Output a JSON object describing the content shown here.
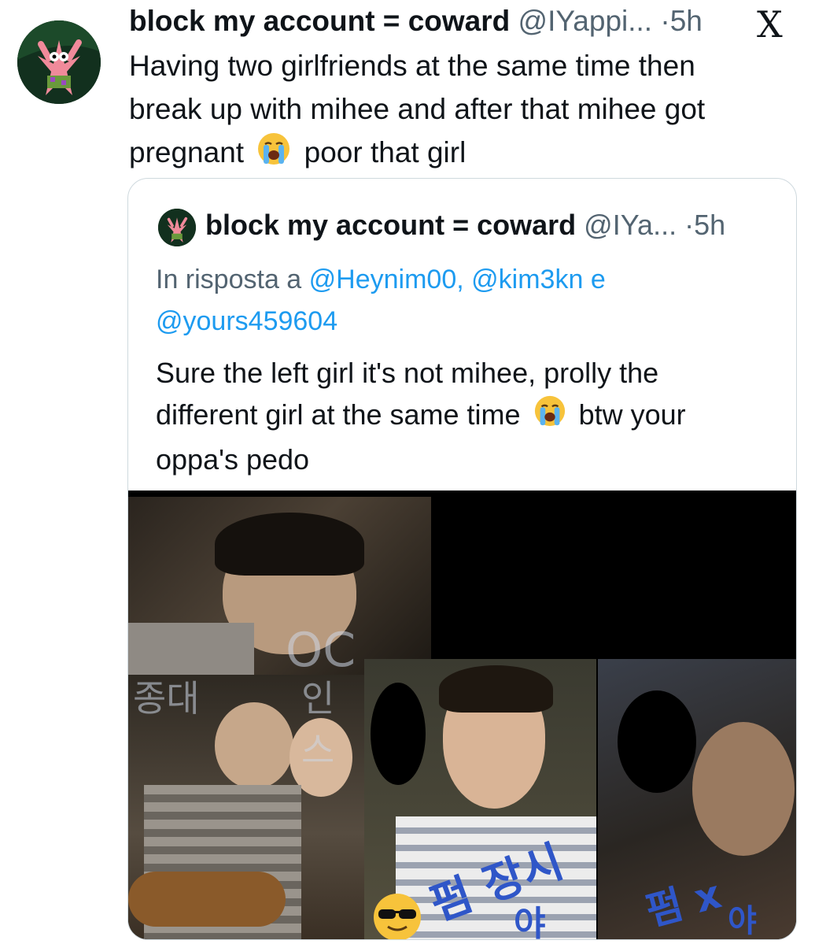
{
  "tweet": {
    "author_name": "block my account = coward",
    "author_handle": "@IYappi...",
    "separator": "·",
    "time": "5h",
    "text_line1": "Having two girlfriends at the same time then",
    "text_line2": "break up with mihee and after that mihee got",
    "text_line3a": "pregnant",
    "text_line3b": "poor that girl"
  },
  "platform_logo": "X",
  "quote": {
    "author_name": "block my account = coward",
    "author_handle": "@IYa...",
    "separator": "·",
    "time": "5h",
    "reply_prefix": "In risposta a",
    "mention1": "@Heynim00,",
    "mention2": "@kim3kn",
    "reply_joiner": "e",
    "mention3": "@yours459604",
    "text_line1": "Sure the left girl it's not mihee, prolly the",
    "text_line2a": "different girl at the same time",
    "text_line2b": "btw your",
    "text_line3": "oppa's pedo"
  },
  "collage": {
    "watermark_top": "OC",
    "watermark_left": "종대",
    "watermark_right": "인스",
    "ink_center": "펌 장시",
    "ink_center_sub": "야",
    "ink_right": "펌 x",
    "ink_right_sub": "야"
  },
  "icons": [
    "crying-emoji-icon",
    "sunglasses-emoji-icon",
    "x-logo-icon"
  ]
}
